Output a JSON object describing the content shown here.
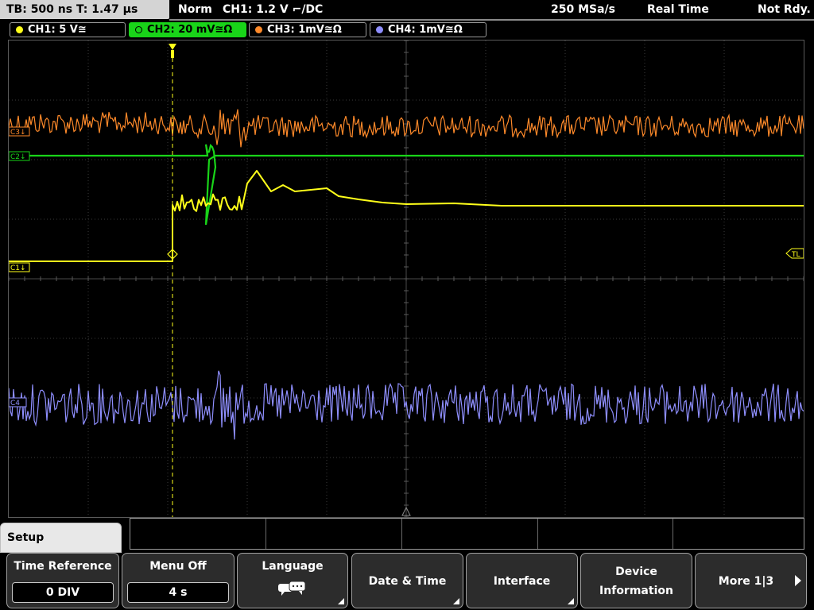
{
  "top": {
    "timebase": "TB: 500 ns   T: 1.47 µs",
    "mode": "Norm",
    "trigger": "CH1: 1.2 V ⌐/DC",
    "sample_rate": "250 MSa/s",
    "acq_mode": "Real Time",
    "status": "Not Rdy."
  },
  "channels": [
    {
      "label": "CH1: 5 V≅",
      "color": "#ffff1a"
    },
    {
      "label": "CH2: 20 mV≅Ω",
      "color": "#19d419"
    },
    {
      "label": "CH3: 1mV≅Ω",
      "color": "#ff8a2a"
    },
    {
      "label": "CH4: 1mV≅Ω",
      "color": "#8f8fff"
    }
  ],
  "markers": {
    "c3": "C3↓",
    "c2": "C2↓",
    "c1": "C1↓",
    "tl": "TL",
    "c4": "C4"
  },
  "menu": {
    "title": "Setup",
    "softkeys": [
      {
        "label": "Time Reference",
        "value": "0 DIV"
      },
      {
        "label": "Menu Off",
        "value": "4 s"
      },
      {
        "label": "Language",
        "icon": "speech-bubbles-icon"
      },
      {
        "label": "Date & Time"
      },
      {
        "label": "Interface"
      },
      {
        "label": "Device",
        "label2": "Information"
      },
      {
        "label": "More 1|3"
      }
    ]
  }
}
